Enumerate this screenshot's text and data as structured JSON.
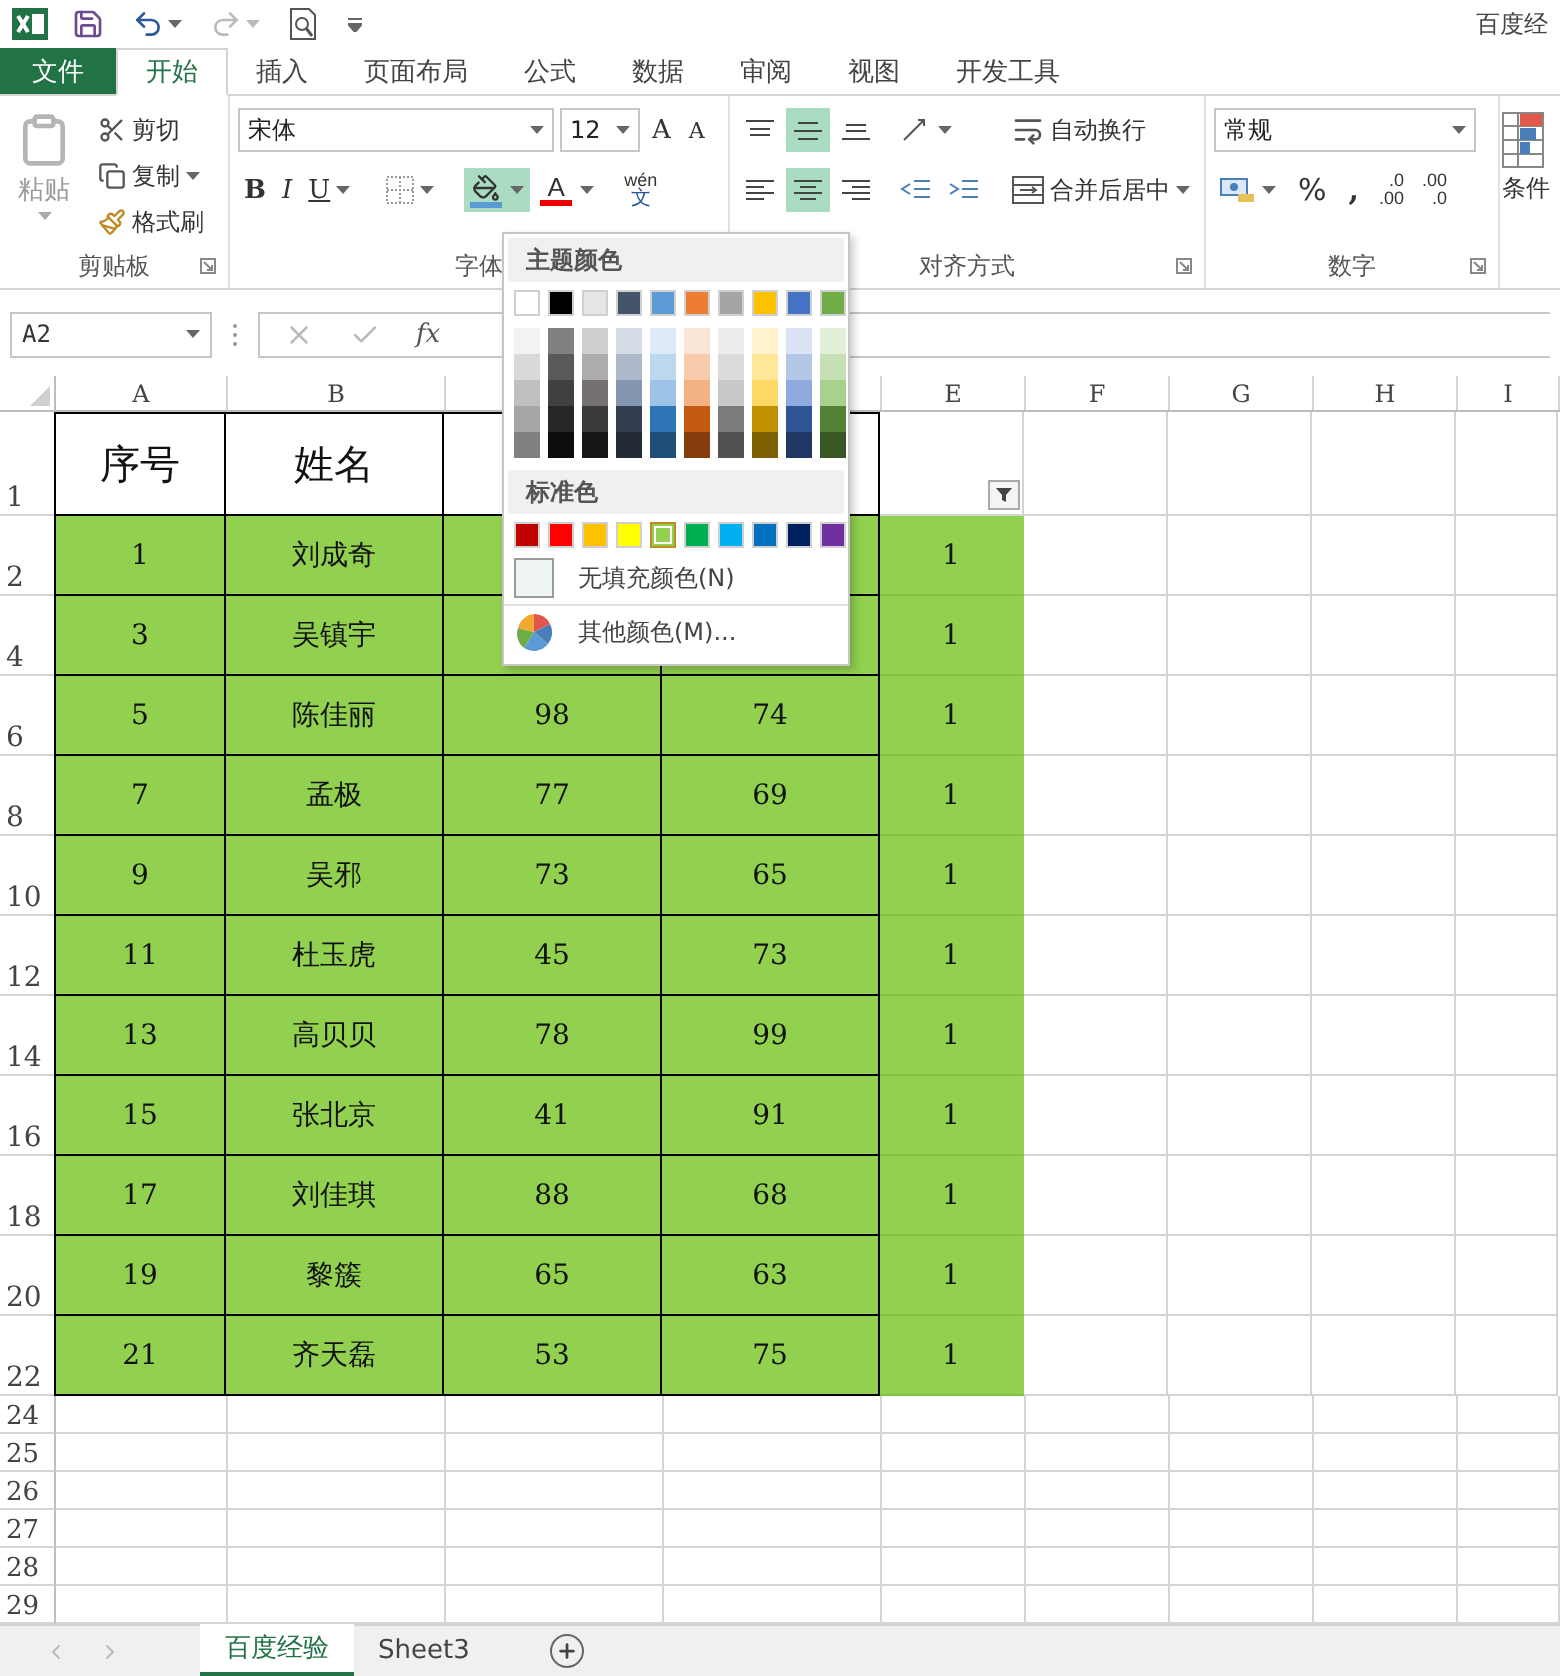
{
  "window": {
    "title": "百度经"
  },
  "ribbon_tabs": [
    {
      "label": "文件",
      "kind": "file",
      "selected": false
    },
    {
      "label": "开始",
      "kind": "tab",
      "selected": true
    },
    {
      "label": "插入",
      "kind": "tab",
      "selected": false
    },
    {
      "label": "页面布局",
      "kind": "tab",
      "selected": false
    },
    {
      "label": "公式",
      "kind": "tab",
      "selected": false
    },
    {
      "label": "数据",
      "kind": "tab",
      "selected": false
    },
    {
      "label": "审阅",
      "kind": "tab",
      "selected": false
    },
    {
      "label": "视图",
      "kind": "tab",
      "selected": false
    },
    {
      "label": "开发工具",
      "kind": "tab",
      "selected": false
    }
  ],
  "ribbon": {
    "clipboard": {
      "label": "剪贴板",
      "paste": {
        "label": "粘贴",
        "disabled": true
      },
      "cut": "剪切",
      "copy": "复制",
      "format_painter": "格式刷"
    },
    "font": {
      "label": "字体",
      "font_name": "宋体",
      "font_size": "12",
      "grow": "A",
      "shrink": "A",
      "bold": "B",
      "italic": "I",
      "underline": "U",
      "fill_pressed": true,
      "font_color": "A",
      "phonetic_top": "wén",
      "phonetic_bottom": "文"
    },
    "alignment": {
      "label": "对齐方式",
      "vertical": [
        {
          "selected": false
        },
        {
          "selected": true
        },
        {
          "selected": false
        }
      ],
      "horizontal": [
        {
          "selected": false
        },
        {
          "selected": true
        },
        {
          "selected": false
        }
      ],
      "wrap": "自动换行",
      "merge": "合并后居中"
    },
    "number": {
      "label": "数字",
      "format": "常规",
      "percent": "%",
      "comma": ",",
      "decimals": [
        {
          "top": ".0",
          "bottom": ".00"
        },
        {
          "top": ".00",
          "bottom": ".0"
        }
      ]
    },
    "styles": {
      "conditional": "条件"
    }
  },
  "formula_bar": {
    "name_box": "A2",
    "fx": "fx"
  },
  "columns": [
    {
      "letter": "A"
    },
    {
      "letter": "B"
    },
    {},
    {},
    {
      "letter": "E"
    },
    {
      "letter": "F"
    },
    {
      "letter": "G"
    },
    {
      "letter": "H"
    },
    {
      "letter": "I"
    }
  ],
  "rows": [
    {
      "number": "1",
      "kind": "header",
      "filled": false,
      "filter": true,
      "cells": [
        "序号",
        "姓名",
        null,
        null,
        null
      ]
    },
    {
      "number": "2",
      "kind": "data",
      "filled": true,
      "cells": [
        "1",
        "刘成奇",
        null,
        null,
        "1"
      ]
    },
    {
      "number": "4",
      "kind": "data",
      "filled": true,
      "cells": [
        "3",
        "吴镇宇",
        null,
        null,
        "1"
      ]
    },
    {
      "number": "6",
      "kind": "data",
      "filled": true,
      "cells": [
        "5",
        "陈佳丽",
        "98",
        "74",
        "1"
      ]
    },
    {
      "number": "8",
      "kind": "data",
      "filled": true,
      "cells": [
        "7",
        "孟极",
        "77",
        "69",
        "1"
      ]
    },
    {
      "number": "10",
      "kind": "data",
      "filled": true,
      "cells": [
        "9",
        "吴邪",
        "73",
        "65",
        "1"
      ]
    },
    {
      "number": "12",
      "kind": "data",
      "filled": true,
      "cells": [
        "11",
        "杜玉虎",
        "45",
        "73",
        "1"
      ]
    },
    {
      "number": "14",
      "kind": "data",
      "filled": true,
      "cells": [
        "13",
        "高贝贝",
        "78",
        "99",
        "1"
      ]
    },
    {
      "number": "16",
      "kind": "data",
      "filled": true,
      "cells": [
        "15",
        "张北京",
        "41",
        "91",
        "1"
      ]
    },
    {
      "number": "18",
      "kind": "data",
      "filled": true,
      "cells": [
        "17",
        "刘佳琪",
        "88",
        "68",
        "1"
      ]
    },
    {
      "number": "20",
      "kind": "data",
      "filled": true,
      "cells": [
        "19",
        "黎簇",
        "65",
        "63",
        "1"
      ]
    },
    {
      "number": "22",
      "kind": "data",
      "filled": true,
      "cells": [
        "21",
        "齐天磊",
        "53",
        "75",
        "1"
      ]
    },
    {
      "number": "24",
      "kind": "empty"
    },
    {
      "number": "25",
      "kind": "empty"
    },
    {
      "number": "26",
      "kind": "empty"
    },
    {
      "number": "27",
      "kind": "empty"
    },
    {
      "number": "28",
      "kind": "empty"
    },
    {
      "number": "29",
      "kind": "empty"
    }
  ],
  "sheet_tabs": [
    {
      "label": "百度经验",
      "selected": true
    },
    {
      "label": "Sheet3",
      "selected": false
    }
  ],
  "fill_menu": {
    "theme_title": "主题颜色",
    "theme": [
      {
        "color": "#ffffff",
        "shades": [
          {
            "color": "#f2f2f2"
          },
          {
            "color": "#d9d9d9"
          },
          {
            "color": "#bfbfbf"
          },
          {
            "color": "#a6a6a6"
          },
          {
            "color": "#808080"
          }
        ]
      },
      {
        "color": "#000000",
        "shades": [
          {
            "color": "#808080"
          },
          {
            "color": "#595959"
          },
          {
            "color": "#404040"
          },
          {
            "color": "#262626"
          },
          {
            "color": "#0d0d0d"
          }
        ]
      },
      {
        "color": "#e7e6e6",
        "shades": [
          {
            "color": "#d0cece"
          },
          {
            "color": "#aeabab"
          },
          {
            "color": "#757171"
          },
          {
            "color": "#3a3838"
          },
          {
            "color": "#171616"
          }
        ]
      },
      {
        "color": "#44546a",
        "shades": [
          {
            "color": "#d6dce5"
          },
          {
            "color": "#adb9ca"
          },
          {
            "color": "#8497b0"
          },
          {
            "color": "#333f50"
          },
          {
            "color": "#222a35"
          }
        ]
      },
      {
        "color": "#5b9bd5",
        "shades": [
          {
            "color": "#deebf7"
          },
          {
            "color": "#bdd7ee"
          },
          {
            "color": "#9dc3e6"
          },
          {
            "color": "#2e75b6"
          },
          {
            "color": "#1f4e79"
          }
        ]
      },
      {
        "color": "#ed7d31",
        "shades": [
          {
            "color": "#fbe5d6"
          },
          {
            "color": "#f8cbad"
          },
          {
            "color": "#f4b183"
          },
          {
            "color": "#c55a11"
          },
          {
            "color": "#843c0c"
          }
        ]
      },
      {
        "color": "#a5a5a5",
        "shades": [
          {
            "color": "#ededed"
          },
          {
            "color": "#dbdbdb"
          },
          {
            "color": "#c9c9c9"
          },
          {
            "color": "#7b7b7b"
          },
          {
            "color": "#525252"
          }
        ]
      },
      {
        "color": "#ffc000",
        "shades": [
          {
            "color": "#fff2cc"
          },
          {
            "color": "#ffe699"
          },
          {
            "color": "#ffd966"
          },
          {
            "color": "#bf9000"
          },
          {
            "color": "#7f6000"
          }
        ]
      },
      {
        "color": "#4472c4",
        "shades": [
          {
            "color": "#dae3f3"
          },
          {
            "color": "#b4c7e7"
          },
          {
            "color": "#8faadc"
          },
          {
            "color": "#2f5597"
          },
          {
            "color": "#203864"
          }
        ]
      },
      {
        "color": "#70ad47",
        "shades": [
          {
            "color": "#e2f0d9"
          },
          {
            "color": "#c5e0b4"
          },
          {
            "color": "#a9d18e"
          },
          {
            "color": "#548235"
          },
          {
            "color": "#385723"
          }
        ]
      }
    ],
    "standard_title": "标准色",
    "standard": [
      {
        "color": "#c00000",
        "selected": false
      },
      {
        "color": "#ff0000",
        "selected": false
      },
      {
        "color": "#ffc000",
        "selected": false
      },
      {
        "color": "#ffff00",
        "selected": false
      },
      {
        "color": "#92d050",
        "selected": true
      },
      {
        "color": "#00b050",
        "selected": false
      },
      {
        "color": "#00b0f0",
        "selected": false
      },
      {
        "color": "#0070c0",
        "selected": false
      },
      {
        "color": "#002060",
        "selected": false
      },
      {
        "color": "#7030a0",
        "selected": false
      }
    ],
    "no_fill": "无填充颜色(N)",
    "more": "其他颜色(M)..."
  }
}
